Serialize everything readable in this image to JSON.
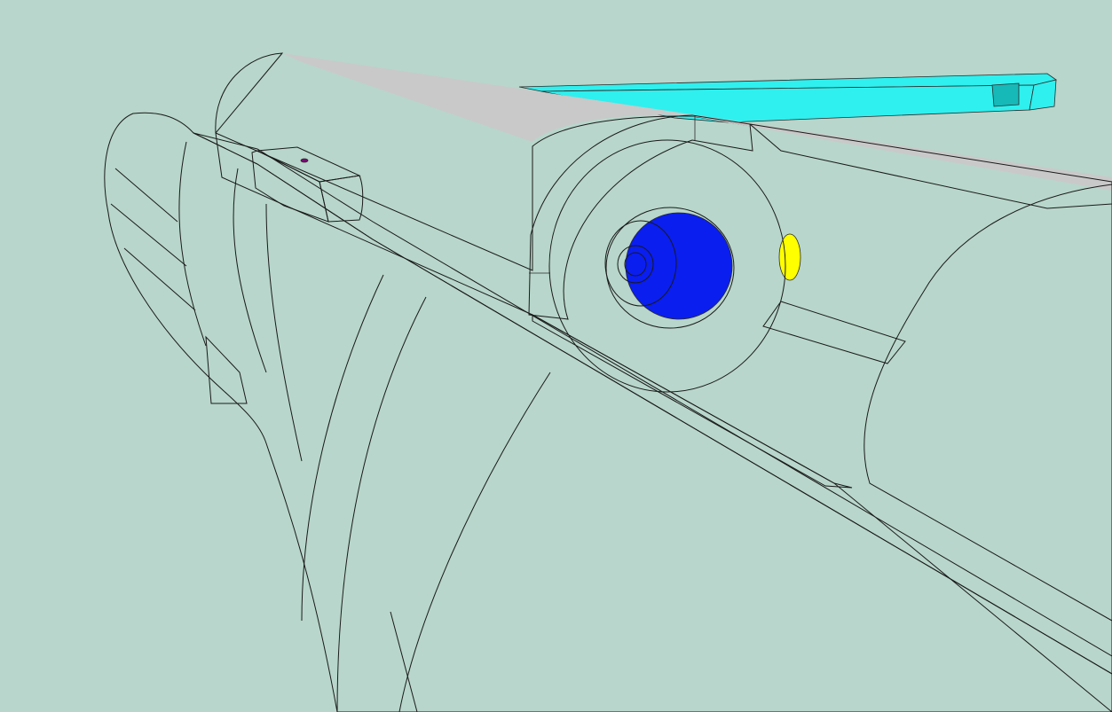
{
  "viewport": {
    "background_color": "#b8d6cb"
  },
  "parts": {
    "stock": {
      "color": "#4a0090",
      "shade_color": "#3d0078",
      "highlight_color": "#5a10b0"
    },
    "barrel": {
      "color": "#aeaeae",
      "shade_color": "#8c8c8c",
      "highlight_color": "#c9c9c9"
    },
    "muzzle_ring": {
      "color": "#ffffff"
    },
    "end_cap": {
      "color": "#0a1ef0",
      "inner_color": "#0014c8"
    },
    "bore": {
      "color": "#b8860b",
      "inner_color": "#8a6208"
    },
    "rail": {
      "color": "#2ff0ee",
      "shade_color": "#16b8b8"
    },
    "trigger_block": {
      "color": "#d21ac8",
      "highlight_color": "#f040e8"
    },
    "yellow_part": {
      "color": "#ffff00"
    }
  }
}
